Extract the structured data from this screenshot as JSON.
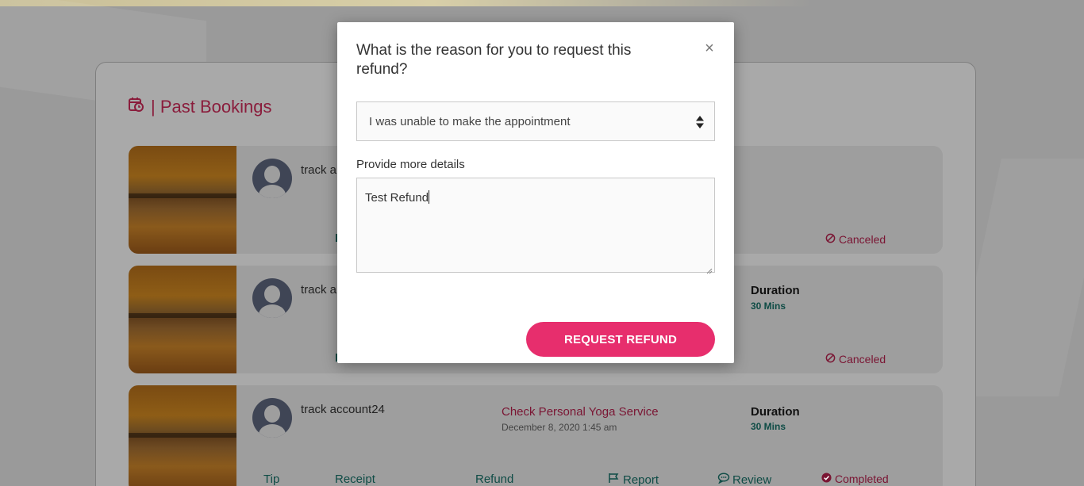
{
  "colors": {
    "accent": "#e72e6d",
    "title_red": "#8a1d3c",
    "teal": "#0f4c46"
  },
  "section": {
    "title": "| Past Bookings",
    "icon": "calendar-clock-icon"
  },
  "bookings": [
    {
      "user": "track a",
      "status": "Canceled",
      "status_icon": "ban-icon",
      "receipt_fragment": "I"
    },
    {
      "user": "track a",
      "duration_label": "Duration",
      "duration_value": "30 Mins",
      "status": "Canceled",
      "status_icon": "ban-icon",
      "receipt_fragment": "I"
    },
    {
      "user": "track account24",
      "service": "Check Personal Yoga Service",
      "date": "December 8, 2020 1:45 am",
      "duration_label": "Duration",
      "duration_value": "30 Mins",
      "actions": {
        "tip": "Tip",
        "receipt": "Receipt",
        "refund": "Refund",
        "report": "Report",
        "review": "Review"
      },
      "status": "Completed",
      "status_icon": "check-circle-icon"
    }
  ],
  "modal": {
    "title": "What is the reason for you to request this refund?",
    "close": "×",
    "reason_selected": "I was unable to make the appointment",
    "details_label": "Provide more details",
    "details_value": "Test Refund",
    "submit": "REQUEST REFUND"
  }
}
